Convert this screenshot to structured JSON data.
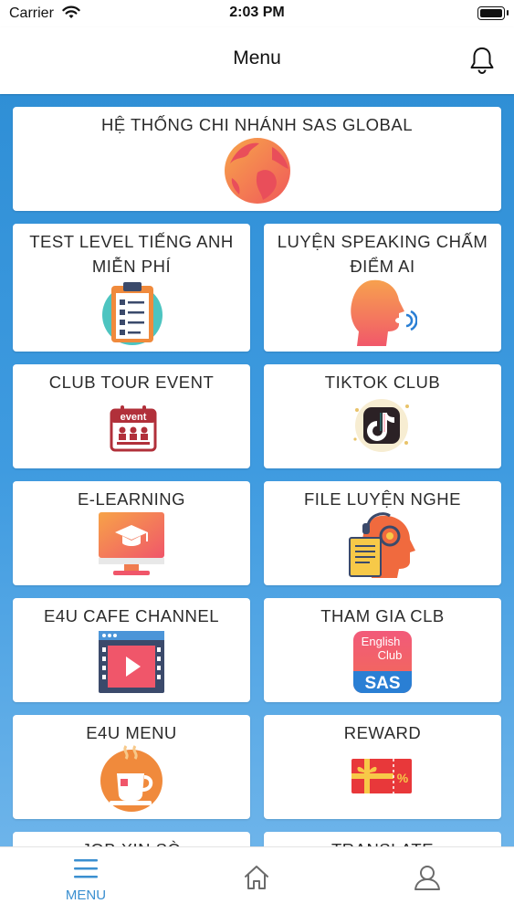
{
  "status": {
    "carrier": "Carrier",
    "time": "2:03 PM"
  },
  "header": {
    "title": "Menu"
  },
  "menu": [
    {
      "label": "HỆ THỐNG CHI NHÁNH SAS GLOBAL",
      "icon": "globe-icon"
    },
    {
      "label": "TEST LEVEL TIẾNG ANH MIỄN PHÍ",
      "icon": "clipboard-checklist-icon"
    },
    {
      "label": "LUYỆN SPEAKING CHẤM ĐIỂM AI",
      "icon": "speaking-head-icon"
    },
    {
      "label": "CLUB TOUR EVENT",
      "icon": "event-calendar-icon"
    },
    {
      "label": "TIKTOK CLUB",
      "icon": "tiktok-icon"
    },
    {
      "label": "E-LEARNING",
      "icon": "elearning-monitor-icon"
    },
    {
      "label": "FILE LUYỆN NGHE",
      "icon": "listening-head-icon"
    },
    {
      "label": "E4U CAFE CHANNEL",
      "icon": "video-player-icon"
    },
    {
      "label": "THAM GIA CLB",
      "icon": "english-club-sas-icon"
    },
    {
      "label": "E4U MENU",
      "icon": "coffee-cup-icon"
    },
    {
      "label": "REWARD",
      "icon": "gift-voucher-icon"
    },
    {
      "label": "JOB XỊN SÒ",
      "icon": "job-icon"
    },
    {
      "label": "TRANSLATE",
      "icon": "translate-icon"
    }
  ],
  "english_club_badge": {
    "line1": "English",
    "line2": "Club",
    "line3": "SAS"
  },
  "event_badge": {
    "text": "event"
  },
  "tabbar": {
    "menu_label": "MENU",
    "accent": "#3a8fd0"
  }
}
